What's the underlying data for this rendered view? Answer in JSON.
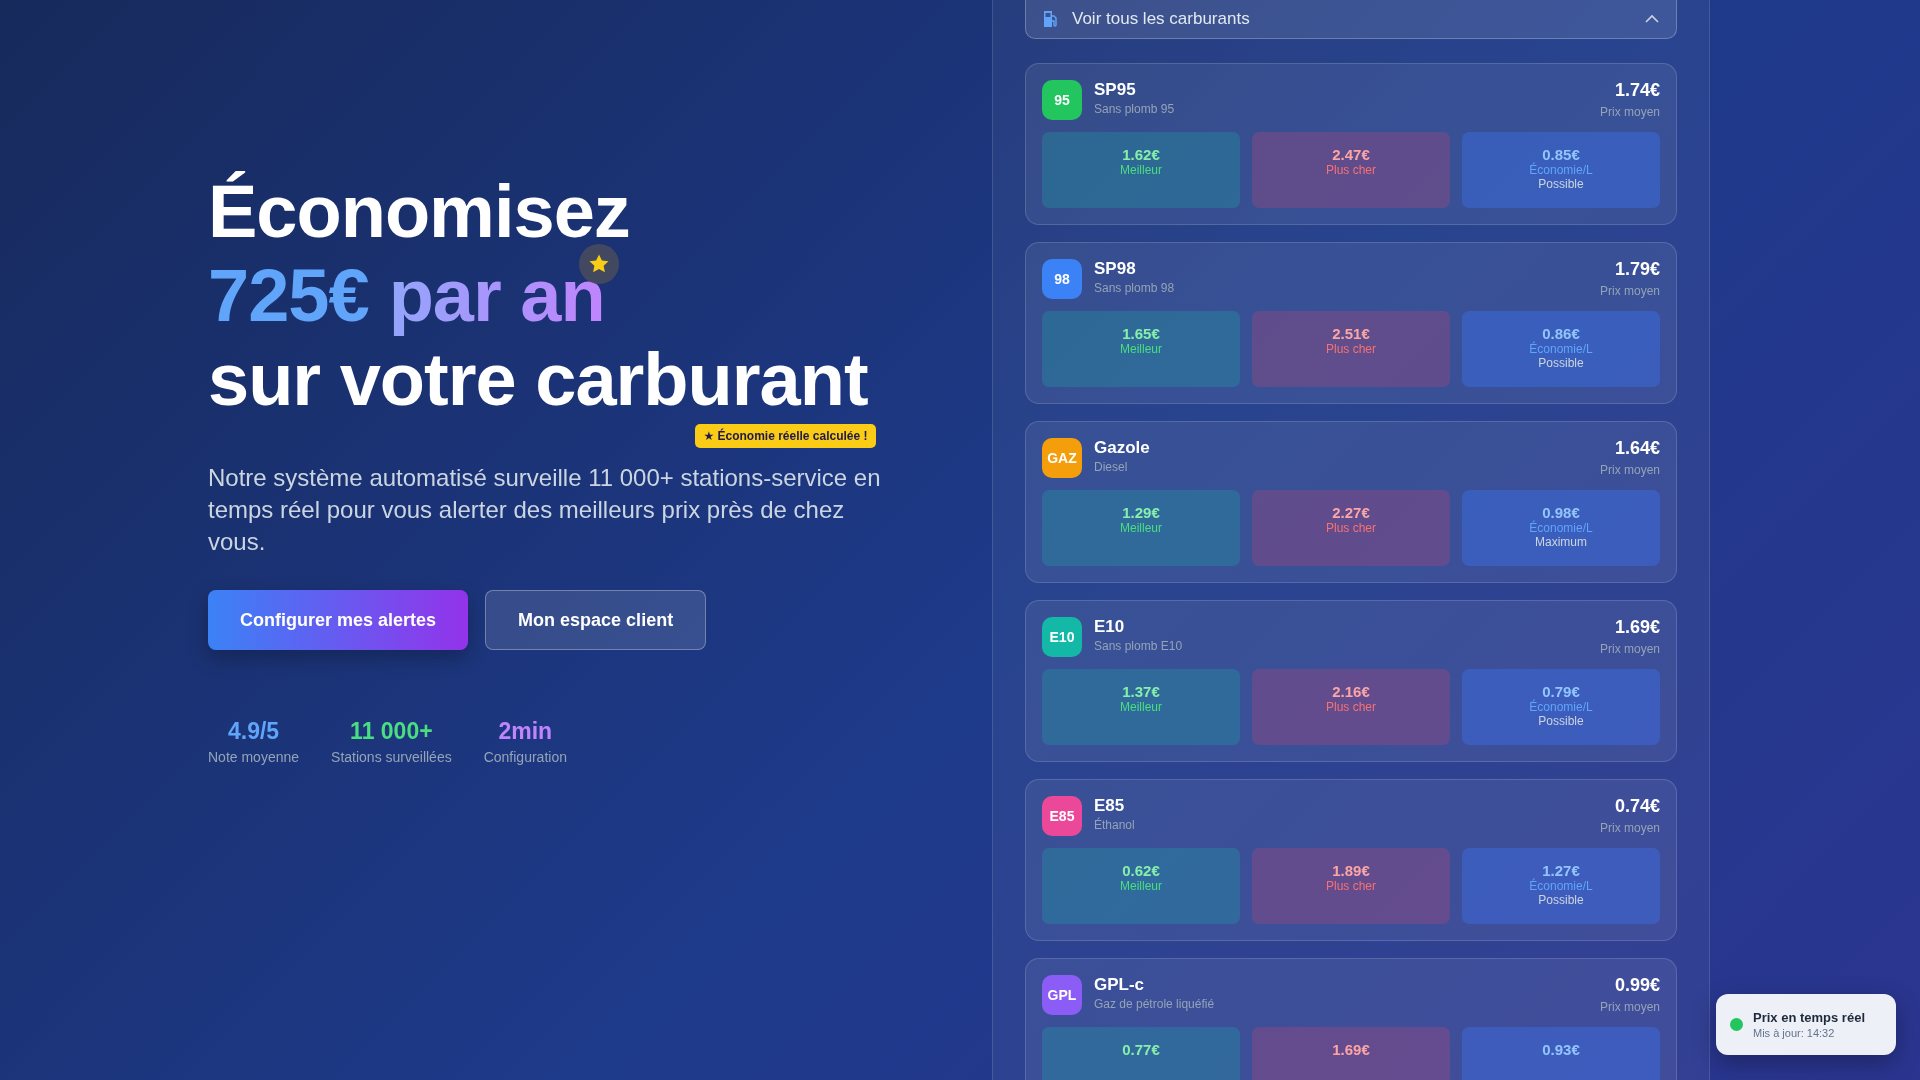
{
  "hero": {
    "title_line1": "Économisez",
    "title_amount": "725€",
    "title_rest": "par an",
    "title_line3": "sur votre carburant",
    "tag": "★ Économie réelle calculée !",
    "description": "Notre système automatisé surveille 11 000+ stations-service en temps réel pour vous alerter des meilleurs prix près de chez vous.",
    "buttons": [
      {
        "label": "Configurer mes alertes",
        "kind": "primary"
      },
      {
        "label": "Mon espace client",
        "kind": "secondary"
      }
    ],
    "stats": [
      {
        "value": "4.9/5",
        "label": "Note moyenne",
        "color": "#60a5fa"
      },
      {
        "value": "11 000+",
        "label": "Stations surveillées",
        "color": "#4ade80"
      },
      {
        "value": "2min",
        "label": "Configuration",
        "color": "#c084fc"
      }
    ]
  },
  "fuel_panel": {
    "toggle": {
      "label": "Voir tous les carburants",
      "expanded": true
    },
    "fuels": [
      {
        "badge": "95",
        "color": "#22c55e",
        "name": "SP95",
        "subtitle": "Sans plomb 95",
        "average": "1.74€",
        "average_label": "Prix moyen",
        "cells": [
          {
            "kind": "best",
            "price": "1.62€",
            "label": "Meilleur"
          },
          {
            "kind": "worst",
            "price": "2.47€",
            "label": "Plus cher"
          },
          {
            "kind": "saving",
            "price": "0.85€",
            "label": "Économie/L",
            "note": "Possible"
          }
        ]
      },
      {
        "badge": "98",
        "color": "#3b82f6",
        "name": "SP98",
        "subtitle": "Sans plomb 98",
        "average": "1.79€",
        "average_label": "Prix moyen",
        "cells": [
          {
            "kind": "best",
            "price": "1.65€",
            "label": "Meilleur"
          },
          {
            "kind": "worst",
            "price": "2.51€",
            "label": "Plus cher"
          },
          {
            "kind": "saving",
            "price": "0.86€",
            "label": "Économie/L",
            "note": "Possible"
          }
        ]
      },
      {
        "badge": "GAZ",
        "color": "#f59e0b",
        "name": "Gazole",
        "subtitle": "Diesel",
        "average": "1.64€",
        "average_label": "Prix moyen",
        "cells": [
          {
            "kind": "best",
            "price": "1.29€",
            "label": "Meilleur"
          },
          {
            "kind": "worst",
            "price": "2.27€",
            "label": "Plus cher"
          },
          {
            "kind": "saving",
            "price": "0.98€",
            "label": "Économie/L",
            "note": "Maximum"
          }
        ]
      },
      {
        "badge": "E10",
        "color": "#14b8a6",
        "name": "E10",
        "subtitle": "Sans plomb E10",
        "average": "1.69€",
        "average_label": "Prix moyen",
        "cells": [
          {
            "kind": "best",
            "price": "1.37€",
            "label": "Meilleur"
          },
          {
            "kind": "worst",
            "price": "2.16€",
            "label": "Plus cher"
          },
          {
            "kind": "saving",
            "price": "0.79€",
            "label": "Économie/L",
            "note": "Possible"
          }
        ]
      },
      {
        "badge": "E85",
        "color": "#ec4899",
        "name": "E85",
        "subtitle": "Éthanol",
        "average": "0.74€",
        "average_label": "Prix moyen",
        "cells": [
          {
            "kind": "best",
            "price": "0.62€",
            "label": "Meilleur"
          },
          {
            "kind": "worst",
            "price": "1.89€",
            "label": "Plus cher"
          },
          {
            "kind": "saving",
            "price": "1.27€",
            "label": "Économie/L",
            "note": "Possible"
          }
        ]
      },
      {
        "badge": "GPL",
        "color": "#8b5cf6",
        "name": "GPL-c",
        "subtitle": "Gaz de pétrole liquéfié",
        "average": "0.99€",
        "average_label": "Prix moyen",
        "cells": [
          {
            "kind": "best",
            "price": "0.77€"
          },
          {
            "kind": "worst",
            "price": "1.69€"
          },
          {
            "kind": "saving",
            "price": "0.93€"
          }
        ]
      }
    ]
  },
  "live_toast": {
    "title": "Prix en temps réel",
    "updated": "Mis à jour: 14:32",
    "color": "#22c55e"
  }
}
